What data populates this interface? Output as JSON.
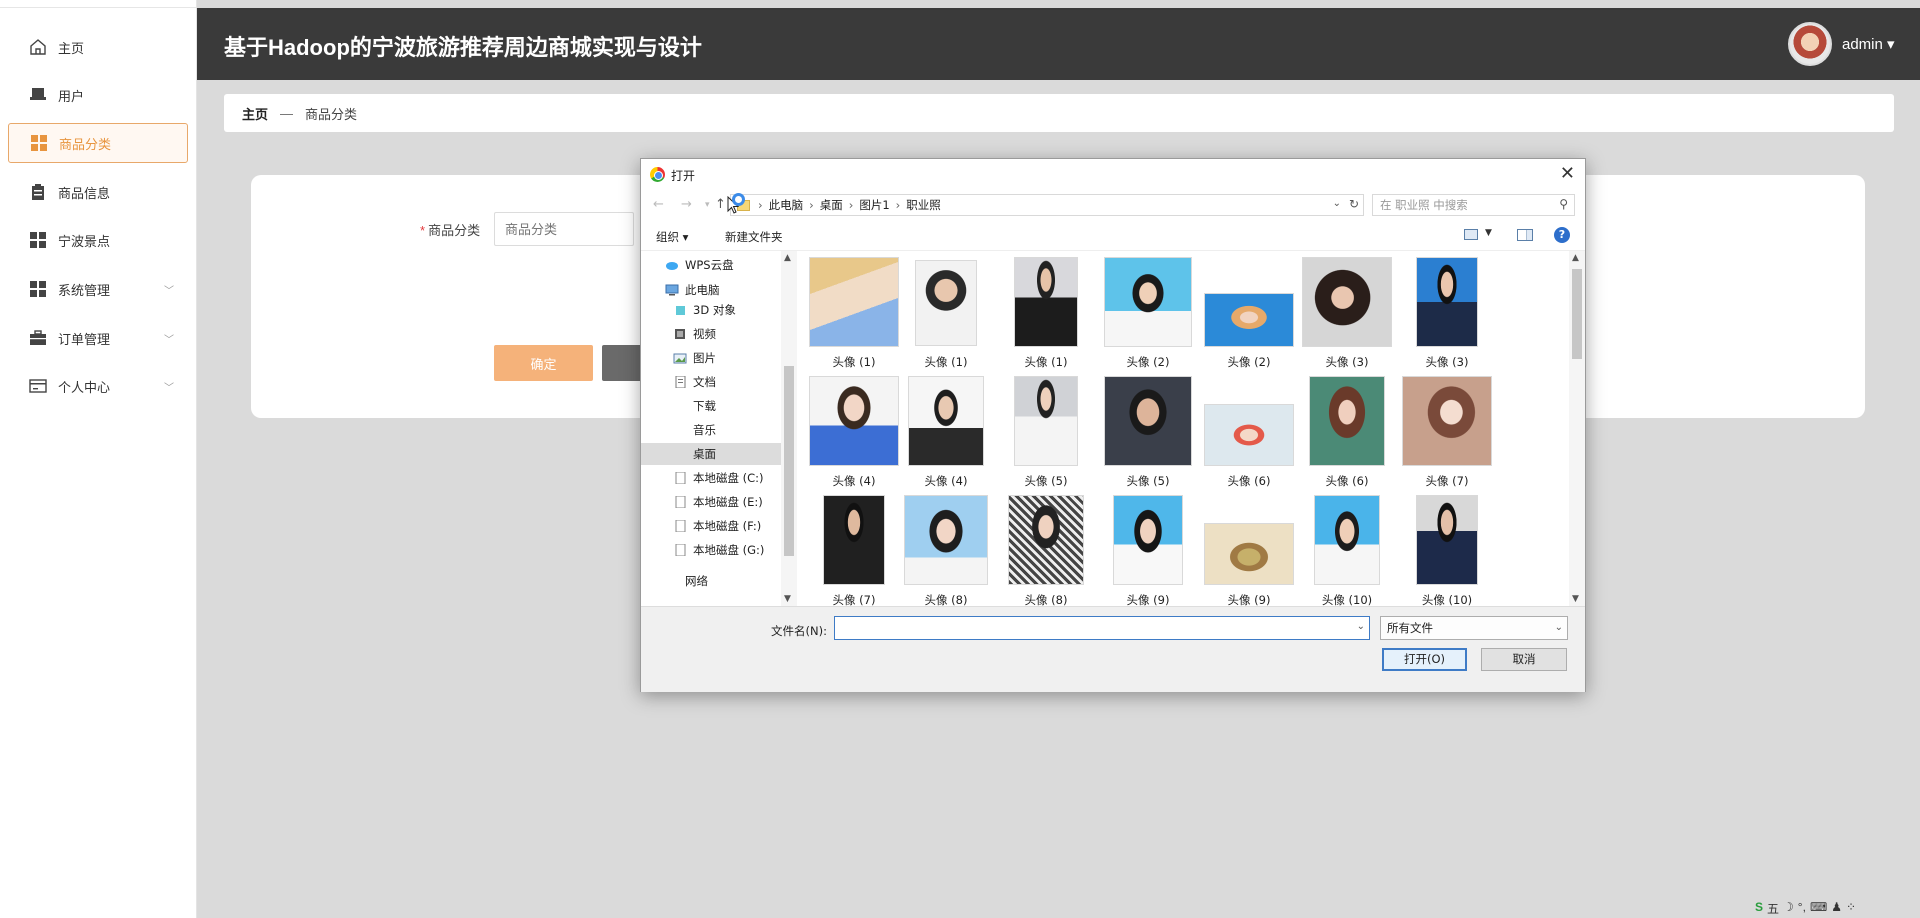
{
  "app": {
    "title": "基于Hadoop的宁波旅游推荐周边商城实现与设计",
    "user": "admin"
  },
  "sidebar": {
    "items": [
      {
        "label": "主页",
        "icon": "home-icon"
      },
      {
        "label": "用户",
        "icon": "user-icon"
      },
      {
        "label": "商品分类",
        "icon": "grid-icon",
        "active": true
      },
      {
        "label": "商品信息",
        "icon": "clipboard-icon"
      },
      {
        "label": "宁波景点",
        "icon": "grid-icon"
      },
      {
        "label": "系统管理",
        "icon": "grid-icon",
        "expandable": true
      },
      {
        "label": "订单管理",
        "icon": "briefcase-icon",
        "expandable": true
      },
      {
        "label": "个人中心",
        "icon": "card-icon",
        "expandable": true
      }
    ]
  },
  "breadcrumb": {
    "home": "主页",
    "sep": "—",
    "current": "商品分类"
  },
  "form": {
    "label": "商品分类",
    "placeholder": "商品分类",
    "confirm": "确定"
  },
  "dialog": {
    "title": "打开",
    "path": [
      "此电脑",
      "桌面",
      "图片1",
      "职业照"
    ],
    "search_placeholder": "在 职业照 中搜索",
    "organize": "组织 ▾",
    "new_folder": "新建文件夹",
    "help": "?",
    "tree": [
      {
        "label": "WPS云盘",
        "icon": "cloud-icon"
      },
      {
        "label": "此电脑",
        "icon": "computer-icon"
      },
      {
        "label": "3D 对象",
        "icon": "cube-icon"
      },
      {
        "label": "视频",
        "icon": "video-icon"
      },
      {
        "label": "图片",
        "icon": "picture-icon"
      },
      {
        "label": "文档",
        "icon": "document-icon"
      },
      {
        "label": "下载",
        "icon": "download-icon"
      },
      {
        "label": "音乐",
        "icon": "music-icon"
      },
      {
        "label": "桌面",
        "icon": "desktop-icon",
        "selected": true
      },
      {
        "label": "本地磁盘 (C:)",
        "icon": "drive-icon"
      },
      {
        "label": "本地磁盘 (E:)",
        "icon": "drive-icon"
      },
      {
        "label": "本地磁盘 (F:)",
        "icon": "drive-icon"
      },
      {
        "label": "本地磁盘 (G:)",
        "icon": "drive-icon"
      },
      {
        "label": "网络",
        "icon": "network-icon"
      }
    ],
    "files": [
      "头像 (1)",
      "头像 (1)",
      "头像 (1)",
      "头像 (2)",
      "头像 (2)",
      "头像 (3)",
      "头像 (3)",
      "头像 (4)",
      "头像 (4)",
      "头像 (5)",
      "头像 (5)",
      "头像 (6)",
      "头像 (6)",
      "头像 (7)",
      "头像 (7)",
      "头像 (8)",
      "头像 (8)",
      "头像 (9)",
      "头像 (9)",
      "头像 (10)",
      "头像 (10)"
    ],
    "filename_label": "文件名(N):",
    "filename_value": "",
    "filetype": "所有文件",
    "open": "打开(O)",
    "cancel": "取消"
  },
  "tray": {
    "ime": "五"
  }
}
